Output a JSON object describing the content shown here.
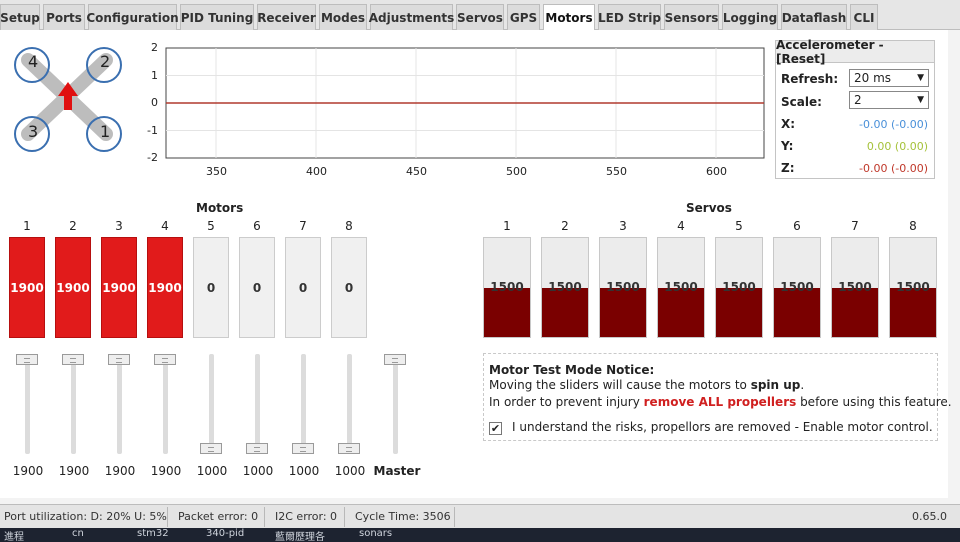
{
  "tabs": [
    "Setup",
    "Ports",
    "Configuration",
    "PID Tuning",
    "Receiver",
    "Modes",
    "Adjustments",
    "Servos",
    "GPS",
    "Motors",
    "LED Strip",
    "Sensors",
    "Logging",
    "Dataflash",
    "CLI"
  ],
  "active_tab": "Motors",
  "quad": {
    "motor_labels": [
      "4",
      "2",
      "3",
      "1"
    ]
  },
  "plot": {
    "y_ticks": [
      "2",
      "1",
      "0",
      "-1",
      "-2"
    ],
    "x_ticks": [
      "350",
      "400",
      "450",
      "500",
      "550",
      "600"
    ]
  },
  "accelerometer": {
    "title": "Accelerometer - [Reset]",
    "refresh_label": "Refresh:",
    "refresh_value": "20 ms",
    "scale_label": "Scale:",
    "scale_value": "2",
    "x_label": "X:",
    "x_value": "-0.00 (-0.00)",
    "y_label": "Y:",
    "y_value": "0.00 (0.00)",
    "z_label": "Z:",
    "z_value": "-0.00 (-0.00)",
    "colors": {
      "x": "#4a90d9",
      "y": "#a6c23b",
      "z": "#c0392b"
    }
  },
  "motors": {
    "title": "Motors",
    "numbers": [
      "1",
      "2",
      "3",
      "4",
      "5",
      "6",
      "7",
      "8"
    ],
    "bar_values": [
      "1900",
      "1900",
      "1900",
      "1900",
      "0",
      "0",
      "0",
      "0"
    ],
    "slider_values": [
      "1900",
      "1900",
      "1900",
      "1900",
      "1000",
      "1000",
      "1000",
      "1000"
    ],
    "master_label": "Master"
  },
  "servos": {
    "title": "Servos",
    "numbers": [
      "1",
      "2",
      "3",
      "4",
      "5",
      "6",
      "7",
      "8"
    ],
    "values": [
      "1500",
      "1500",
      "1500",
      "1500",
      "1500",
      "1500",
      "1500",
      "1500"
    ],
    "level": 0.5
  },
  "notice": {
    "title": "Motor Test Mode Notice:",
    "line1_pre": "Moving the sliders will cause the motors to ",
    "line1_bold": "spin up",
    "line1_post": ".",
    "line2_pre": "In order to prevent injury ",
    "line2_red": "remove ALL propellers",
    "line2_post": " before using this feature.",
    "checkbox_checked": "✔",
    "checkbox_label": "I understand the risks, propellors are removed - Enable motor control."
  },
  "status": {
    "port_util": "Port utilization: D: 20% U: 5%",
    "packet_error": "Packet error: 0",
    "i2c_error": "I2C error: 0",
    "cycle_time": "Cycle Time: 3506",
    "version": "0.65.0"
  },
  "taskbar": [
    "進程",
    "cn",
    "stm32",
    "340-pid",
    "藍爾歷理各",
    "sonars"
  ]
}
